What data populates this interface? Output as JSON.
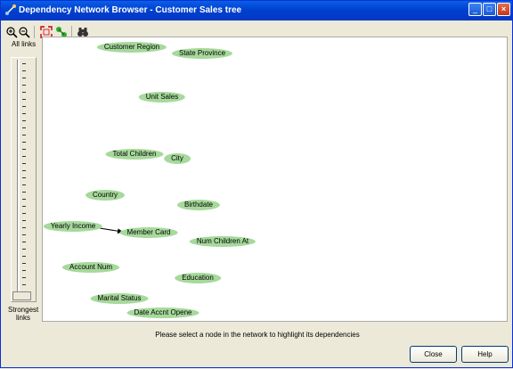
{
  "window": {
    "title": "Dependency Network Browser - Customer Sales tree"
  },
  "toolbar": {
    "icons": [
      "zoom-in-icon",
      "zoom-out-icon",
      "fit-to-window-icon",
      "link-icon",
      "binoculars-icon"
    ]
  },
  "slider": {
    "top_label": "All links",
    "bottom_label": "Strongest links",
    "value": 0
  },
  "network": {
    "nodes": [
      {
        "label": "Customer Region"
      },
      {
        "label": "State Province"
      },
      {
        "label": "Unit Sales"
      },
      {
        "label": "Total Children"
      },
      {
        "label": "City"
      },
      {
        "label": "Country"
      },
      {
        "label": "Birthdate"
      },
      {
        "label": "Yearly Income"
      },
      {
        "label": "Member Card"
      },
      {
        "label": "Num Children At"
      },
      {
        "label": "Account Num"
      },
      {
        "label": "Education"
      },
      {
        "label": "Marital Status"
      },
      {
        "label": "Date Accnt Opene"
      }
    ],
    "edges": [
      {
        "from": "Yearly Income",
        "to": "Member Card"
      }
    ]
  },
  "status_text": "Please select a node in the network to highlight its dependencies",
  "buttons": {
    "close_label": "Close",
    "help_label": "Help"
  },
  "colors": {
    "node_fill": "#a6d99b",
    "titlebar": "#0041d0"
  }
}
